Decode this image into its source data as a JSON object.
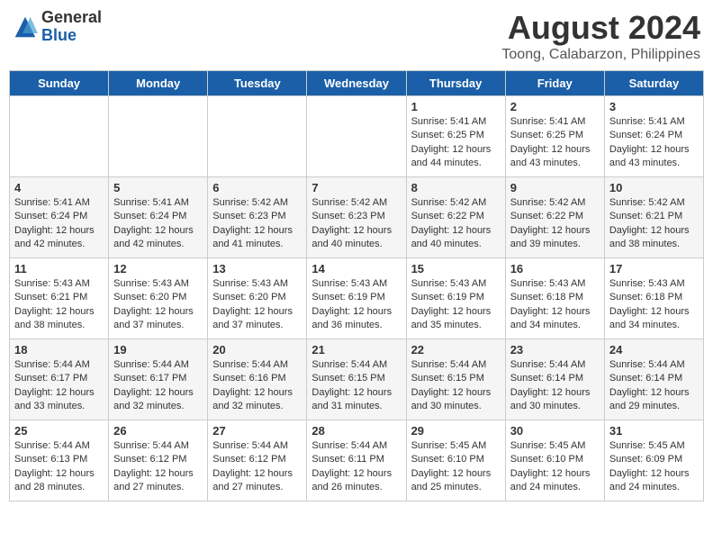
{
  "header": {
    "logo_general": "General",
    "logo_blue": "Blue",
    "month_title": "August 2024",
    "location": "Toong, Calabarzon, Philippines"
  },
  "days_of_week": [
    "Sunday",
    "Monday",
    "Tuesday",
    "Wednesday",
    "Thursday",
    "Friday",
    "Saturday"
  ],
  "weeks": [
    [
      {
        "day": "",
        "info": ""
      },
      {
        "day": "",
        "info": ""
      },
      {
        "day": "",
        "info": ""
      },
      {
        "day": "",
        "info": ""
      },
      {
        "day": "1",
        "info": "Sunrise: 5:41 AM\nSunset: 6:25 PM\nDaylight: 12 hours\nand 44 minutes."
      },
      {
        "day": "2",
        "info": "Sunrise: 5:41 AM\nSunset: 6:25 PM\nDaylight: 12 hours\nand 43 minutes."
      },
      {
        "day": "3",
        "info": "Sunrise: 5:41 AM\nSunset: 6:24 PM\nDaylight: 12 hours\nand 43 minutes."
      }
    ],
    [
      {
        "day": "4",
        "info": "Sunrise: 5:41 AM\nSunset: 6:24 PM\nDaylight: 12 hours\nand 42 minutes."
      },
      {
        "day": "5",
        "info": "Sunrise: 5:41 AM\nSunset: 6:24 PM\nDaylight: 12 hours\nand 42 minutes."
      },
      {
        "day": "6",
        "info": "Sunrise: 5:42 AM\nSunset: 6:23 PM\nDaylight: 12 hours\nand 41 minutes."
      },
      {
        "day": "7",
        "info": "Sunrise: 5:42 AM\nSunset: 6:23 PM\nDaylight: 12 hours\nand 40 minutes."
      },
      {
        "day": "8",
        "info": "Sunrise: 5:42 AM\nSunset: 6:22 PM\nDaylight: 12 hours\nand 40 minutes."
      },
      {
        "day": "9",
        "info": "Sunrise: 5:42 AM\nSunset: 6:22 PM\nDaylight: 12 hours\nand 39 minutes."
      },
      {
        "day": "10",
        "info": "Sunrise: 5:42 AM\nSunset: 6:21 PM\nDaylight: 12 hours\nand 38 minutes."
      }
    ],
    [
      {
        "day": "11",
        "info": "Sunrise: 5:43 AM\nSunset: 6:21 PM\nDaylight: 12 hours\nand 38 minutes."
      },
      {
        "day": "12",
        "info": "Sunrise: 5:43 AM\nSunset: 6:20 PM\nDaylight: 12 hours\nand 37 minutes."
      },
      {
        "day": "13",
        "info": "Sunrise: 5:43 AM\nSunset: 6:20 PM\nDaylight: 12 hours\nand 37 minutes."
      },
      {
        "day": "14",
        "info": "Sunrise: 5:43 AM\nSunset: 6:19 PM\nDaylight: 12 hours\nand 36 minutes."
      },
      {
        "day": "15",
        "info": "Sunrise: 5:43 AM\nSunset: 6:19 PM\nDaylight: 12 hours\nand 35 minutes."
      },
      {
        "day": "16",
        "info": "Sunrise: 5:43 AM\nSunset: 6:18 PM\nDaylight: 12 hours\nand 34 minutes."
      },
      {
        "day": "17",
        "info": "Sunrise: 5:43 AM\nSunset: 6:18 PM\nDaylight: 12 hours\nand 34 minutes."
      }
    ],
    [
      {
        "day": "18",
        "info": "Sunrise: 5:44 AM\nSunset: 6:17 PM\nDaylight: 12 hours\nand 33 minutes."
      },
      {
        "day": "19",
        "info": "Sunrise: 5:44 AM\nSunset: 6:17 PM\nDaylight: 12 hours\nand 32 minutes."
      },
      {
        "day": "20",
        "info": "Sunrise: 5:44 AM\nSunset: 6:16 PM\nDaylight: 12 hours\nand 32 minutes."
      },
      {
        "day": "21",
        "info": "Sunrise: 5:44 AM\nSunset: 6:15 PM\nDaylight: 12 hours\nand 31 minutes."
      },
      {
        "day": "22",
        "info": "Sunrise: 5:44 AM\nSunset: 6:15 PM\nDaylight: 12 hours\nand 30 minutes."
      },
      {
        "day": "23",
        "info": "Sunrise: 5:44 AM\nSunset: 6:14 PM\nDaylight: 12 hours\nand 30 minutes."
      },
      {
        "day": "24",
        "info": "Sunrise: 5:44 AM\nSunset: 6:14 PM\nDaylight: 12 hours\nand 29 minutes."
      }
    ],
    [
      {
        "day": "25",
        "info": "Sunrise: 5:44 AM\nSunset: 6:13 PM\nDaylight: 12 hours\nand 28 minutes."
      },
      {
        "day": "26",
        "info": "Sunrise: 5:44 AM\nSunset: 6:12 PM\nDaylight: 12 hours\nand 27 minutes."
      },
      {
        "day": "27",
        "info": "Sunrise: 5:44 AM\nSunset: 6:12 PM\nDaylight: 12 hours\nand 27 minutes."
      },
      {
        "day": "28",
        "info": "Sunrise: 5:44 AM\nSunset: 6:11 PM\nDaylight: 12 hours\nand 26 minutes."
      },
      {
        "day": "29",
        "info": "Sunrise: 5:45 AM\nSunset: 6:10 PM\nDaylight: 12 hours\nand 25 minutes."
      },
      {
        "day": "30",
        "info": "Sunrise: 5:45 AM\nSunset: 6:10 PM\nDaylight: 12 hours\nand 24 minutes."
      },
      {
        "day": "31",
        "info": "Sunrise: 5:45 AM\nSunset: 6:09 PM\nDaylight: 12 hours\nand 24 minutes."
      }
    ]
  ]
}
